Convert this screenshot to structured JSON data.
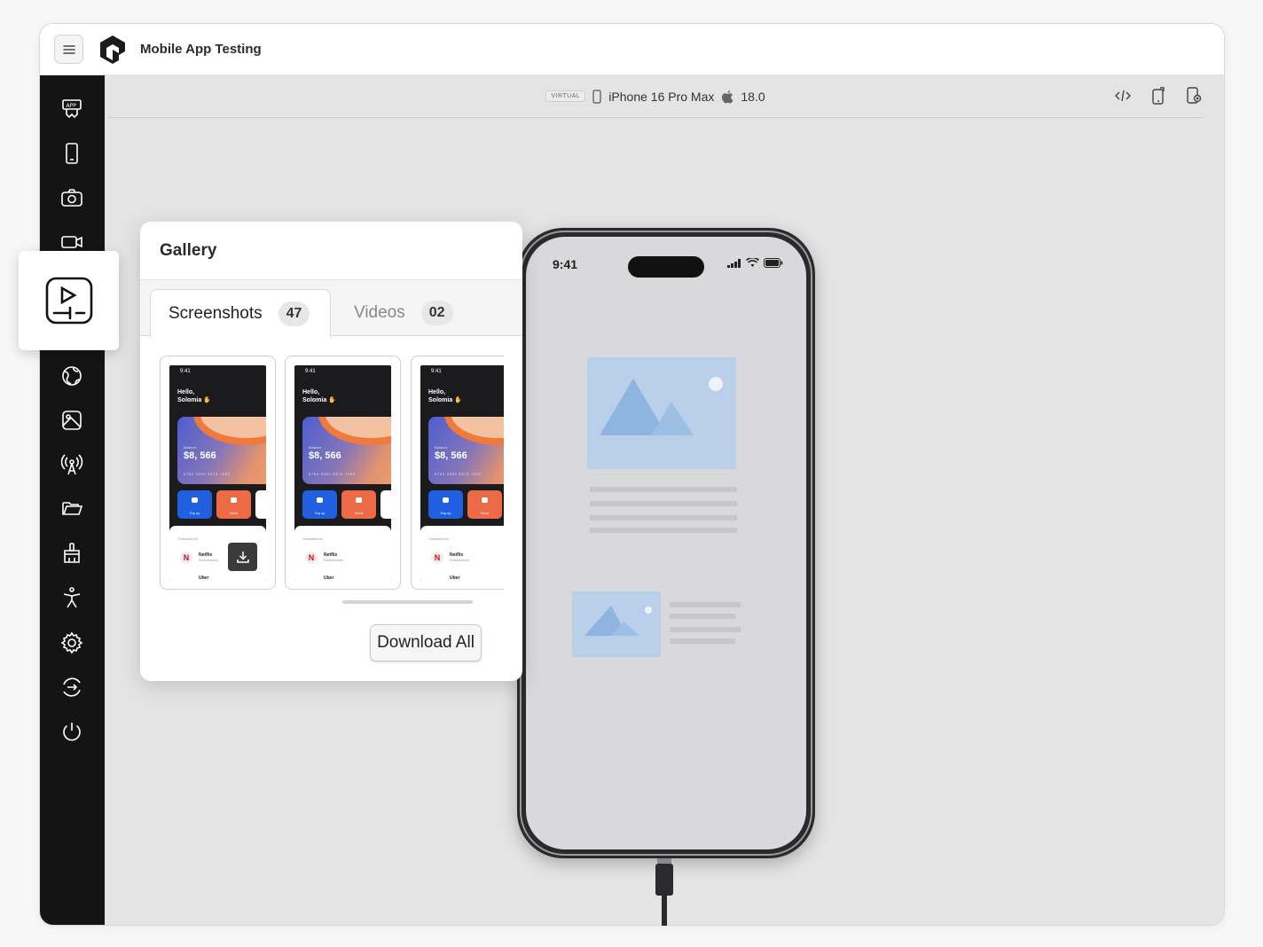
{
  "app": {
    "title": "Mobile App Testing"
  },
  "device": {
    "badge": "VIRTUAL",
    "name": "iPhone 16 Pro Max",
    "os_version": "18.0"
  },
  "sidebar": {
    "icons": [
      "app-icon",
      "mobile-device-icon",
      "camera-icon",
      "video-camera-icon",
      "gallery-media-icon",
      "globe-icon",
      "image-icon",
      "signal-tower-icon",
      "folder-icon",
      "cleaner-icon",
      "accessibility-icon",
      "settings-icon",
      "switch-icon",
      "power-icon"
    ],
    "active": "gallery-media-icon"
  },
  "toolbar": {
    "icons": [
      "code-icon",
      "rotate-device-icon",
      "device-settings-icon"
    ]
  },
  "gallery": {
    "title": "Gallery",
    "tabs": [
      {
        "label": "Screenshots",
        "count": "47",
        "active": true
      },
      {
        "label": "Videos",
        "count": "02",
        "active": false
      }
    ],
    "thumbnail": {
      "time": "9:41",
      "greeting": "Hello,",
      "name": "Solomia",
      "balance_label": "Balance",
      "balance": "$8, 566",
      "card_number": "5750 3050 8875 7900",
      "top_up": "Top up",
      "send": "Send",
      "transactions": "Transactions",
      "merchant1": "Netflix",
      "merchant1_sub": "Entertainment",
      "merchant2": "Uber"
    },
    "download_all": "Download All"
  },
  "phone": {
    "time": "9:41"
  },
  "colors": {
    "sidebar": "#141414",
    "accent_blue": "#1f5fe0",
    "accent_orange": "#ed6a46",
    "placeholder_blue": "#b7cfea"
  }
}
